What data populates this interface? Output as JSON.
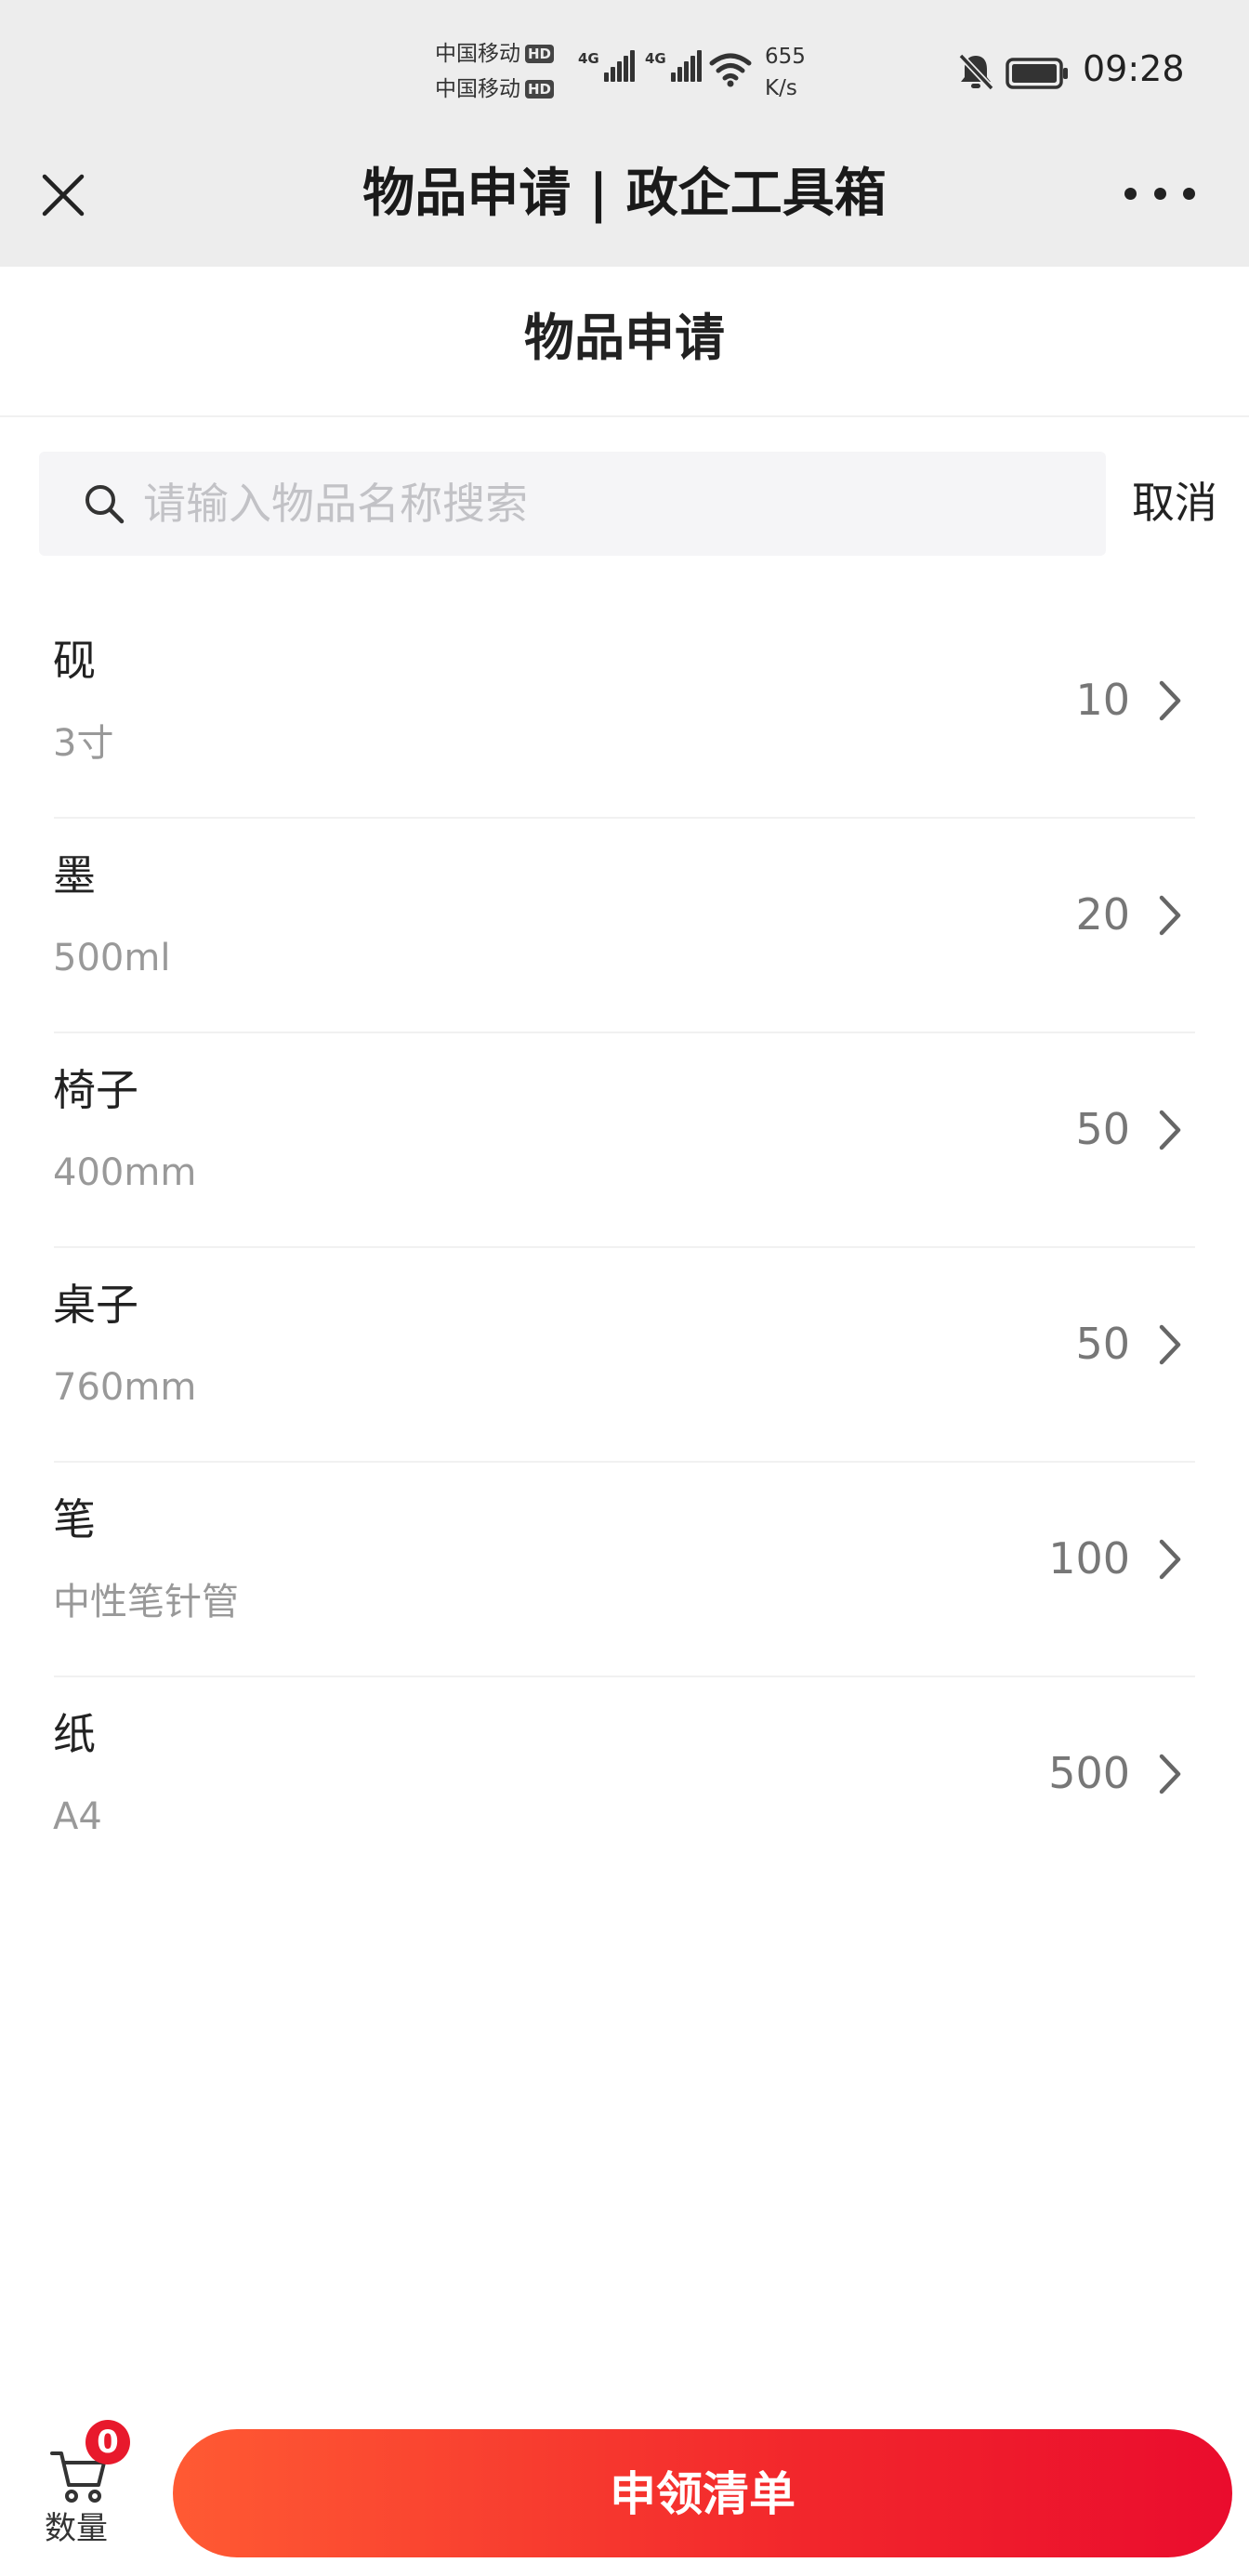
{
  "status_bar": {
    "carrier_1": "中国移动",
    "carrier_2": "中国移动",
    "hd_label": "HD",
    "network_1": "4G",
    "network_2": "4G",
    "speed_value": "655",
    "speed_unit": "K/s",
    "time": "09:28"
  },
  "titlebar": {
    "title": "物品申请 | 政企工具箱"
  },
  "page": {
    "title": "物品申请"
  },
  "search": {
    "placeholder": "请输入物品名称搜索",
    "value": "",
    "cancel_label": "取消"
  },
  "items": [
    {
      "name": "砚",
      "spec": "3寸",
      "qty": "10"
    },
    {
      "name": "墨",
      "spec": "500ml",
      "qty": "20"
    },
    {
      "name": "椅子",
      "spec": "400mm",
      "qty": "50"
    },
    {
      "name": "桌子",
      "spec": "760mm",
      "qty": "50"
    },
    {
      "name": "笔",
      "spec": "中性笔针管",
      "qty": "100"
    },
    {
      "name": "纸",
      "spec": "A4",
      "qty": "500"
    }
  ],
  "bottom_bar": {
    "cart_count": "0",
    "cart_label": "数量",
    "apply_label": "申领清单"
  },
  "colors": {
    "accent_red": "#e8192c",
    "button_gradient_start": "#ff5a33",
    "button_gradient_end": "#ea0c2d"
  }
}
